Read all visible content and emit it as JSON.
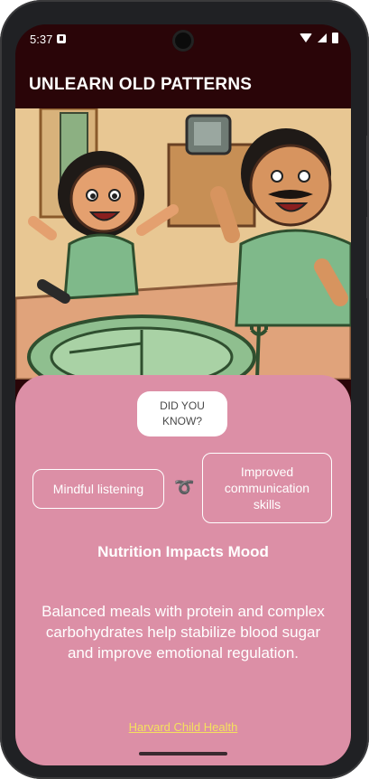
{
  "status_bar": {
    "time": "5:37"
  },
  "app_bar": {
    "title": "UNLEARN OLD PATTERNS"
  },
  "hero": {
    "icon": "illustration-child-and-father"
  },
  "card": {
    "tag": "DID YOU\nKNOW?",
    "left_box": "Mindful listening",
    "connector_icon": "swirl-icon",
    "connector_glyph": "➰",
    "right_box": "Improved communication skills",
    "heading": "Nutrition Impacts Mood",
    "body": "Balanced meals with protein and complex carbohydrates help stabilize blood sugar and improve emotional regulation.",
    "source_link": "Harvard Child Health"
  },
  "colors": {
    "app_bar": "#2a0508",
    "card": "#dc8fa6",
    "link": "#f4e15e"
  }
}
